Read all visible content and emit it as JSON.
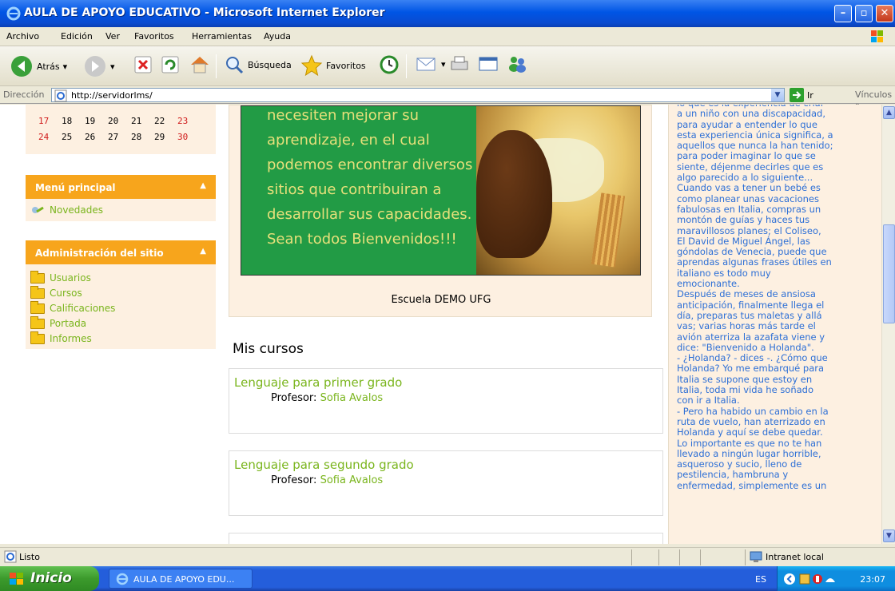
{
  "window": {
    "title": "AULA DE APOYO EDUCATIVO - Microsoft Internet Explorer"
  },
  "menu": [
    "Archivo",
    "Edición",
    "Ver",
    "Favoritos",
    "Herramientas",
    "Ayuda"
  ],
  "toolbar": {
    "back": "Atrás",
    "search": "Búsqueda",
    "favorites": "Favoritos"
  },
  "address": {
    "label": "Dirección",
    "url": "http://servidorlms/",
    "go": "Ir",
    "links": "Vínculos"
  },
  "calendar": {
    "row1": [
      "17",
      "18",
      "19",
      "20",
      "21",
      "22",
      "23"
    ],
    "row2": [
      "24",
      "25",
      "26",
      "27",
      "28",
      "29",
      "30"
    ]
  },
  "main_menu": {
    "title": "Menú principal",
    "items": [
      "Novedades"
    ]
  },
  "admin": {
    "title": "Administración del sitio",
    "items": [
      "Usuarios",
      "Cursos",
      "Calificaciones",
      "Portada",
      "Informes"
    ]
  },
  "hero": {
    "text": "necesiten mejorar su aprendizaje, en el cual podemos encontrar diversos sitios que contribuiran a desarrollar sus capacidades. Sean todos Bienvenidos!!!",
    "caption": "Escuela DEMO UFG"
  },
  "courses": {
    "heading": "Mis cursos",
    "items": [
      {
        "name": "Lenguaje para primer grado",
        "prof_label": "Profesor:",
        "prof": "Sofia Avalos"
      },
      {
        "name": "Lenguaje para segundo grado",
        "prof_label": "Profesor:",
        "prof": "Sofia Avalos"
      }
    ]
  },
  "right_text": "lo que es la experiencia de criar\na un niño con una discapacidad,\npara ayudar a entender lo que\nesta experiencia única significa, a\naquellos que nunca la han tenido;\npara poder imaginar lo que se\nsiente, déjenme decirles que es\nalgo parecido a lo siguiente...\nCuando vas a tener un bebé es\ncomo planear unas vacaciones\nfabulosas en Italia, compras un\nmontón de guías y haces tus\nmaravillosos planes; el Coliseo,\nEl David de Miguel Ángel, las\ngóndolas de Venecia, puede que\naprendas algunas frases útiles en\nitaliano es todo muy\nemocionante.\nDespués de meses de ansiosa\nanticipación, finalmente llega el\ndía, preparas tus maletas y allá\nvas; varias horas más tarde el\navión aterriza la azafata viene y\ndice: \"Bienvenido a Holanda\".\n- ¿Holanda? - dices -. ¿Cómo que\nHolanda? Yo me embarqué para\nItalia se supone que estoy en\nItalia, toda mi vida he soñado\ncon ir a Italia.\n- Pero ha habido un cambio en la\nruta de vuelo, han aterrizado en\nHolanda y aquí se debe quedar.\nLo importante es que no te han\nllevado a ningún lugar horrible,\nasqueroso y sucio, lleno de\npestilencia, hambruna y\nenfermedad, simplemente es un",
  "status": {
    "text": "Listo",
    "zone": "Intranet local"
  },
  "taskbar": {
    "start": "Inicio",
    "task": "AULA DE APOYO EDU...",
    "lang": "ES",
    "clock": "23:07"
  },
  "colors": {
    "accent_orange": "#f7a51c",
    "link_green": "#7ab51d",
    "hero_green": "#229b45",
    "right_text_blue": "#2d6fd6"
  }
}
